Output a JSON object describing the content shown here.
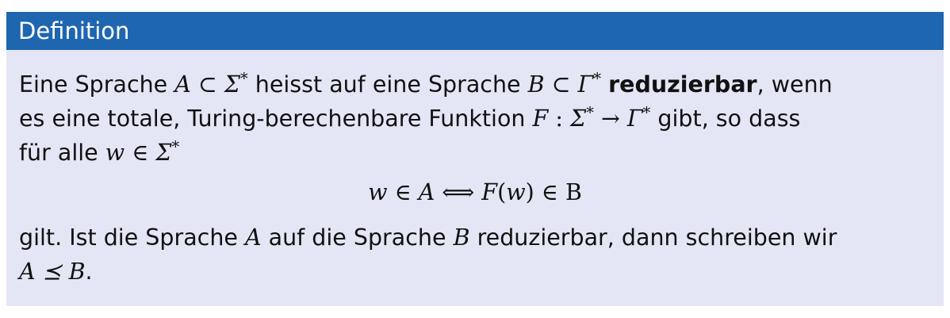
{
  "block": {
    "title": "Definition",
    "line1": {
      "t1": "Eine Sprache ",
      "m1": "A ⊂ Σ",
      "m1sup": "*",
      "t2": " heisst auf eine Sprache ",
      "m2": "B ⊂ Γ",
      "m2sup": "*",
      "bold": "reduzierbar",
      "t3": ", wenn"
    },
    "line2": {
      "t1": "es eine totale, Turing-berechenbare Funktion ",
      "m1": "F",
      "m2": " : ",
      "m3": "Σ",
      "m3sup": "*",
      "m4": " → Γ",
      "m4sup": "*",
      "t2": " gibt, so dass"
    },
    "line3": {
      "t1": "für alle ",
      "m1": "w ∈ Σ",
      "m1sup": "*"
    },
    "display": {
      "m1": "w ∈ A",
      "m2": " ⟺ ",
      "m3": "F",
      "m4": "(",
      "m5": "w",
      "m6": ") ∈ B"
    },
    "line4": {
      "t1": "gilt. Ist die Sprache ",
      "m1": "A",
      "t2": " auf die Sprache ",
      "m2": "B",
      "t3": " reduzierbar, dann schreiben wir"
    },
    "line5": {
      "m1": "A ⪯ B",
      "t1": "."
    }
  }
}
